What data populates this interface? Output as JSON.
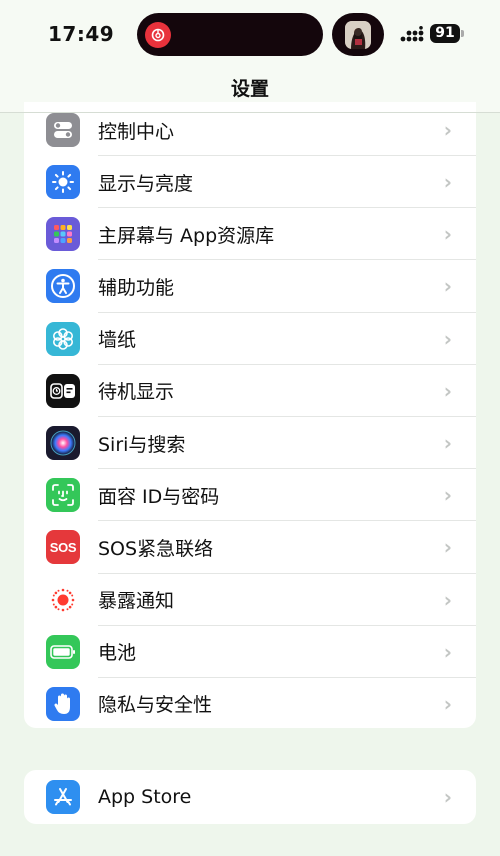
{
  "status_bar": {
    "time": "17:49",
    "battery_level": "91"
  },
  "nav": {
    "title": "设置"
  },
  "settings": [
    {
      "label": "控制中心",
      "icon": "control-center-icon",
      "color": "#8e8e93"
    },
    {
      "label": "显示与亮度",
      "icon": "brightness-icon",
      "color": "#2f7bf0"
    },
    {
      "label": "主屏幕与 App资源库",
      "icon": "home-screen-icon",
      "color": "#6a5bd8"
    },
    {
      "label": "辅助功能",
      "icon": "accessibility-icon",
      "color": "#2f7bf0"
    },
    {
      "label": "墙纸",
      "icon": "wallpaper-icon",
      "color": "#36b7d6"
    },
    {
      "label": "待机显示",
      "icon": "standby-icon",
      "color": "#111111"
    },
    {
      "label": "Siri与搜索",
      "icon": "siri-icon",
      "color": "#222222"
    },
    {
      "label": "面容 ID与密码",
      "icon": "face-id-icon",
      "color": "#34c759"
    },
    {
      "label": "SOS紧急联络",
      "icon": "sos-icon",
      "color": "#e5383b"
    },
    {
      "label": "暴露通知",
      "icon": "exposure-notification-icon",
      "color": "#ffffff"
    },
    {
      "label": "电池",
      "icon": "battery-icon",
      "color": "#34c759"
    },
    {
      "label": "隐私与安全性",
      "icon": "privacy-hand-icon",
      "color": "#2f7bf0"
    }
  ],
  "store": {
    "label": "App Store",
    "icon": "app-store-icon",
    "color": "#2e8ff0"
  },
  "sos_text": "SOS"
}
